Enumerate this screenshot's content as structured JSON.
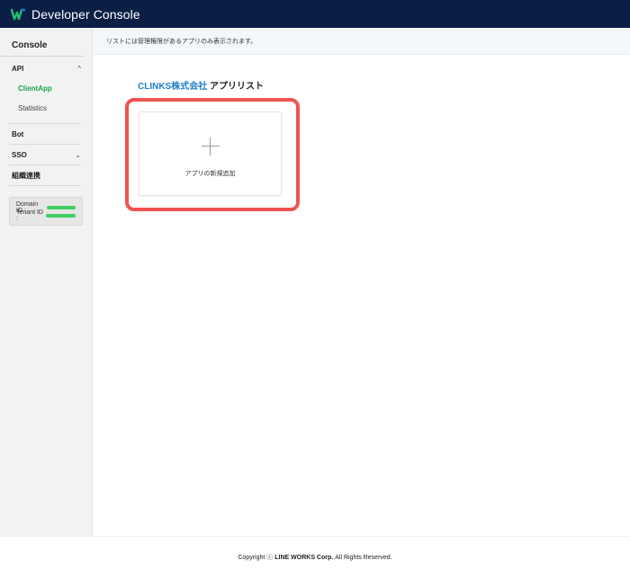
{
  "header": {
    "title": "Developer Console",
    "logo_icon": "line-works-logo-icon",
    "colors": {
      "background": "#0b1f45",
      "logo": "#20c070"
    }
  },
  "sidebar": {
    "heading": "Console",
    "api": {
      "label": "API",
      "chevron": "^"
    },
    "api_items": [
      {
        "label": "ClientApp",
        "active": true
      },
      {
        "label": "Statistics",
        "active": false
      }
    ],
    "bot": {
      "label": "Bot"
    },
    "sso": {
      "label": "SSO",
      "chevron": "⌄"
    },
    "org": {
      "label": "組織連携"
    },
    "ids": {
      "domain_label": "Domain ID :",
      "tenant_label": "Tenant ID :"
    }
  },
  "notice": {
    "text": "リストには管理権限があるアプリのみ表示されます。"
  },
  "main": {
    "company": "CLINKS株式会社",
    "list_title": " アプリリスト",
    "add_card": {
      "label": "アプリの新規追加",
      "icon": "plus-icon"
    },
    "highlight_color": "#ef5350"
  },
  "footer": {
    "prefix": "Copyright ⓒ ",
    "company": "LINE WORKS Corp.",
    "suffix": " All Rights Reserved."
  }
}
